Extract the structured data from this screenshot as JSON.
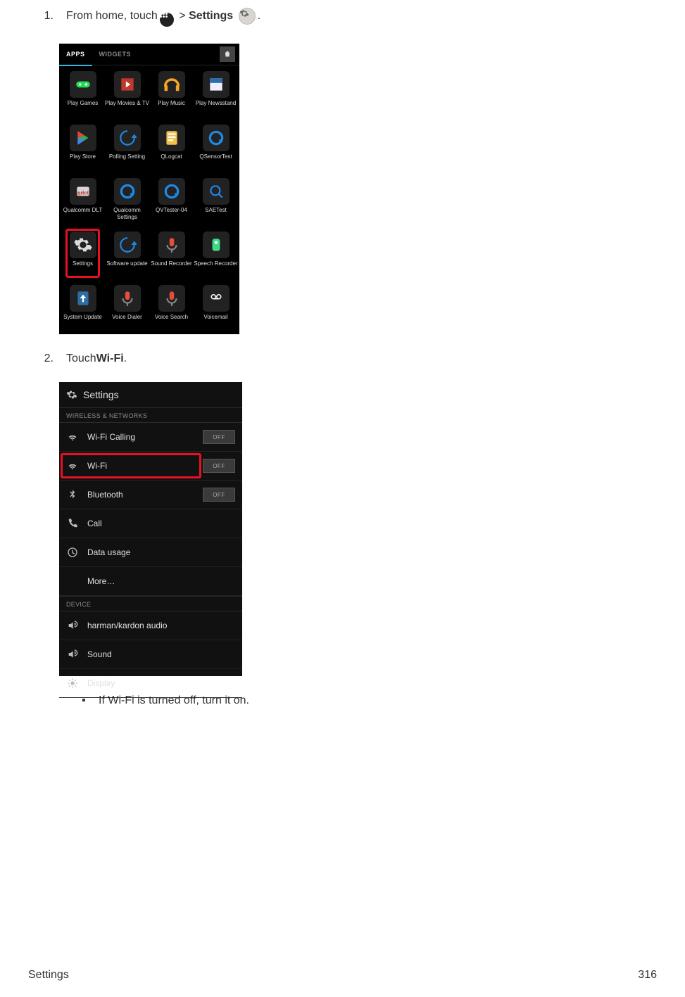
{
  "step1": {
    "num": "1.",
    "pre": "From home, touch ",
    "gt": ">",
    "settings_bold": "Settings",
    "period": "."
  },
  "step2": {
    "num": "2.",
    "pre": "Touch ",
    "wifi_bold": "Wi-Fi",
    "period": "."
  },
  "note": {
    "bullet": "▪",
    "text": "If Wi-Fi is turned off, turn it on."
  },
  "drawer": {
    "tab_apps": "APPS",
    "tab_widgets": "WIDGETS",
    "apps": [
      {
        "label": "Play Games",
        "cls": "ic-playgames"
      },
      {
        "label": "Play Movies & TV",
        "cls": "ic-playmovies"
      },
      {
        "label": "Play Music",
        "cls": "ic-playmusic"
      },
      {
        "label": "Play Newsstand",
        "cls": "ic-playnews"
      },
      {
        "label": "Play Store",
        "cls": "ic-playstore"
      },
      {
        "label": "Polling Setting",
        "cls": "ic-polling"
      },
      {
        "label": "QLogcat",
        "cls": "ic-qlogcat"
      },
      {
        "label": "QSensorTest",
        "cls": "ic-qsensor"
      },
      {
        "label": "Qualcomm DLT",
        "cls": "ic-qdlt"
      },
      {
        "label": "Qualcomm Settings",
        "cls": "ic-qsettings"
      },
      {
        "label": "QVTester-04",
        "cls": "ic-qvtester"
      },
      {
        "label": "SAETest",
        "cls": "ic-saetest"
      },
      {
        "label": "Settings",
        "cls": "ic-settings",
        "hl": true
      },
      {
        "label": "Software update",
        "cls": "ic-swupdate"
      },
      {
        "label": "Sound Recorder",
        "cls": "ic-soundrec"
      },
      {
        "label": "Speech Recorder",
        "cls": "ic-speechrec"
      },
      {
        "label": "System Update",
        "cls": "ic-sysupdate"
      },
      {
        "label": "Voice Dialer",
        "cls": "ic-voicedial"
      },
      {
        "label": "Voice Search",
        "cls": "ic-voicesearch"
      },
      {
        "label": "Voicemail",
        "cls": "ic-voicemail"
      }
    ]
  },
  "settings_screen": {
    "title": "Settings",
    "cat1": "WIRELESS & NETWORKS",
    "cat2": "DEVICE",
    "off": "OFF",
    "rows1": [
      {
        "label": "Wi-Fi Calling",
        "icon": "wifi",
        "toggle": true
      },
      {
        "label": "Wi-Fi",
        "icon": "wifi",
        "toggle": true,
        "hl": true
      },
      {
        "label": "Bluetooth",
        "icon": "bt",
        "toggle": true
      },
      {
        "label": "Call",
        "icon": "phone"
      },
      {
        "label": "Data usage",
        "icon": "data"
      },
      {
        "label": "More…",
        "icon": "",
        "more": true
      }
    ],
    "rows2": [
      {
        "label": "harman/kardon audio",
        "icon": "sound"
      },
      {
        "label": "Sound",
        "icon": "sound"
      },
      {
        "label": "Display",
        "icon": "display"
      }
    ]
  },
  "footer": {
    "left": "Settings",
    "right": "316"
  }
}
